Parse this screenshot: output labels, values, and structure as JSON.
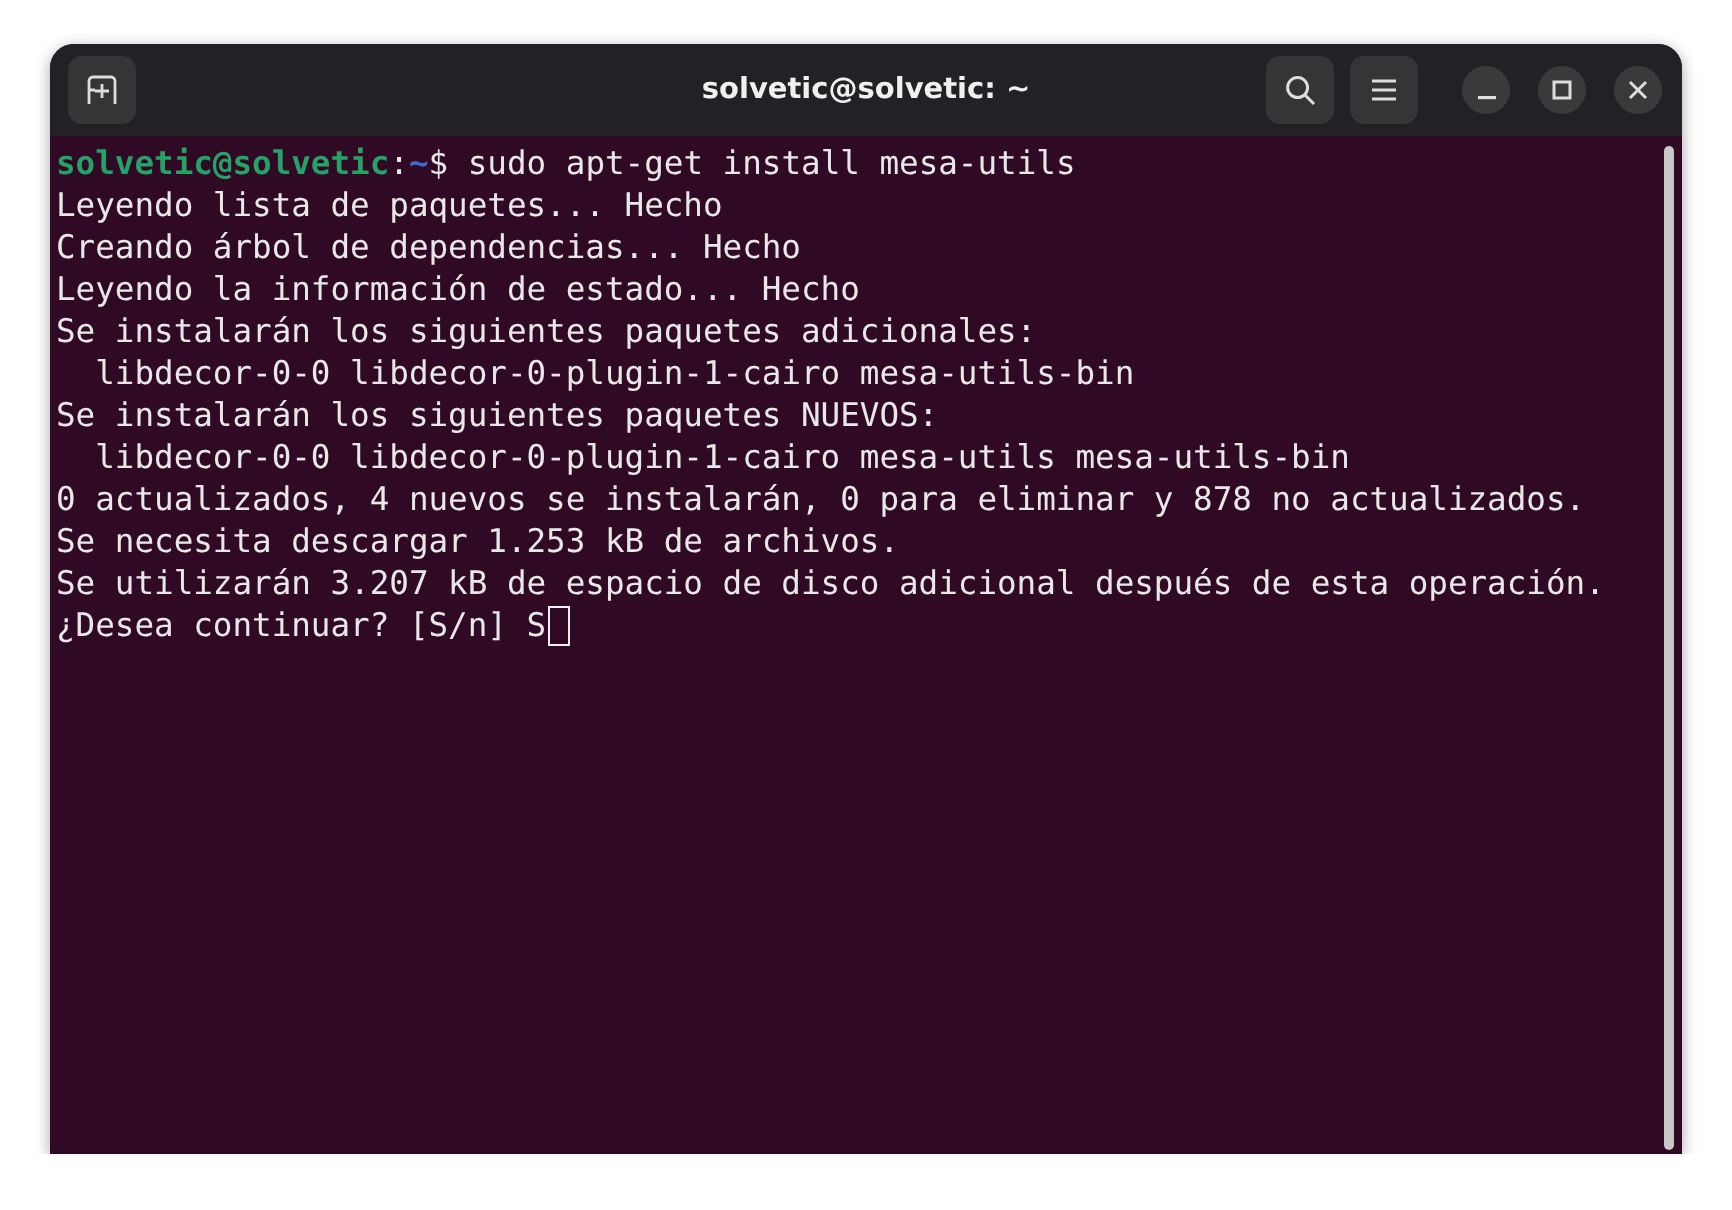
{
  "window": {
    "title": "solvetic@solvetic: ~"
  },
  "terminal": {
    "prompt": {
      "user_host": "solvetic@solvetic",
      "separator": ":",
      "path": "~",
      "symbol": "$",
      "command": " sudo apt-get install mesa-utils"
    },
    "lines": [
      "Leyendo lista de paquetes... Hecho",
      "Creando árbol de dependencias... Hecho",
      "Leyendo la información de estado... Hecho",
      "Se instalarán los siguientes paquetes adicionales:",
      "  libdecor-0-0 libdecor-0-plugin-1-cairo mesa-utils-bin",
      "Se instalarán los siguientes paquetes NUEVOS:",
      "  libdecor-0-0 libdecor-0-plugin-1-cairo mesa-utils mesa-utils-bin",
      "0 actualizados, 4 nuevos se instalarán, 0 para eliminar y 878 no actualizados.",
      "Se necesita descargar 1.253 kB de archivos.",
      "Se utilizarán 3.207 kB de espacio de disco adicional después de esta operación."
    ],
    "input_line": {
      "text": "¿Desea continuar? [S/n] S",
      "cursor": true
    }
  }
}
